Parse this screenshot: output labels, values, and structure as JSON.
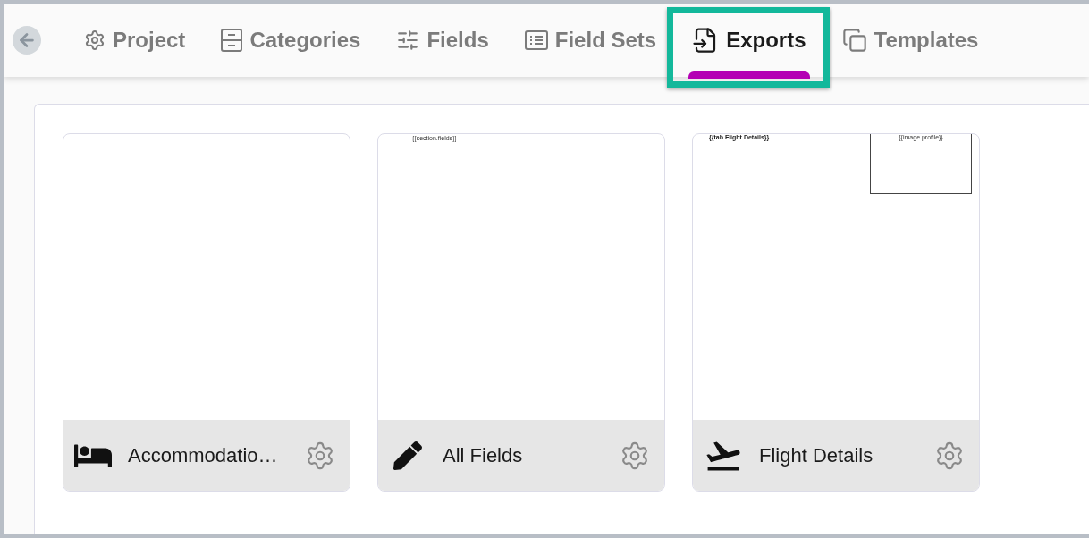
{
  "tabs": [
    {
      "label": "Project",
      "selected": false,
      "highlighted": false
    },
    {
      "label": "Categories",
      "selected": false,
      "highlighted": false
    },
    {
      "label": "Fields",
      "selected": false,
      "highlighted": false
    },
    {
      "label": "Field Sets",
      "selected": false,
      "highlighted": false
    },
    {
      "label": "Exports",
      "selected": true,
      "highlighted": true
    },
    {
      "label": "Templates",
      "selected": false,
      "highlighted": false
    }
  ],
  "exports": [
    {
      "name": "Accommodatio…",
      "kind": "bed"
    },
    {
      "name": "All Fields",
      "kind": "pen",
      "preview": [
        {
          "kind": "text",
          "text": "{{section.fields}}"
        }
      ]
    },
    {
      "name": "Flight Details",
      "kind": "plane",
      "preview": [
        {
          "kind": "heading",
          "text": "{{tab.Flight Details}}"
        },
        {
          "kind": "image",
          "text": "{{image.profile}}"
        }
      ]
    }
  ]
}
